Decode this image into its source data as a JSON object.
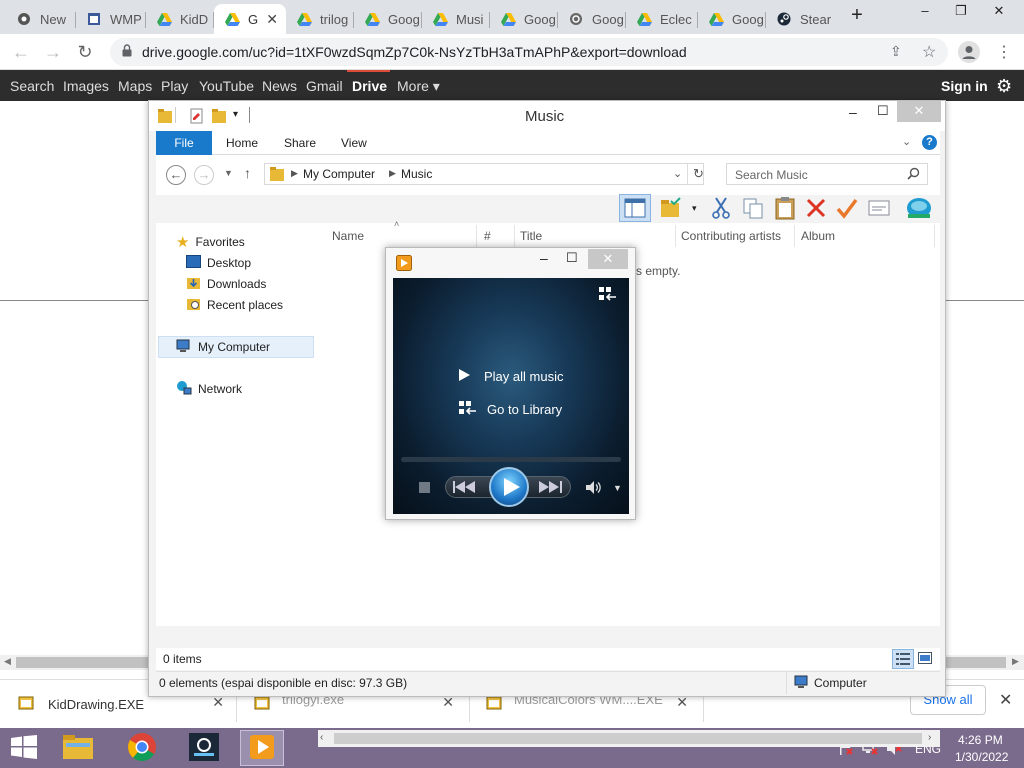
{
  "browser": {
    "tabs": [
      {
        "label": "New",
        "icon": "chrome-icon"
      },
      {
        "label": "WMP",
        "icon": "window-icon"
      },
      {
        "label": "KidD",
        "icon": "google-drive-icon"
      },
      {
        "label": "G",
        "icon": "google-drive-icon",
        "active": true
      },
      {
        "label": "trilog",
        "icon": "google-drive-icon"
      },
      {
        "label": "Goog",
        "icon": "google-drive-icon"
      },
      {
        "label": "Musi",
        "icon": "google-drive-icon"
      },
      {
        "label": "Goog",
        "icon": "google-drive-icon"
      },
      {
        "label": "Goog",
        "icon": "globe-icon"
      },
      {
        "label": "Eclec",
        "icon": "google-drive-icon"
      },
      {
        "label": "Goog",
        "icon": "google-drive-icon"
      },
      {
        "label": "Stear",
        "icon": "steam-icon"
      }
    ],
    "new_tab": "+",
    "url": "drive.google.com/uc?id=1tXF0wzdSqmZp7C0k-NsYzTbH3aTmAPhP&export=download"
  },
  "google_bar": {
    "items": [
      "Search",
      "Images",
      "Maps",
      "Play",
      "YouTube",
      "News",
      "Gmail",
      "Drive",
      "More ▾"
    ],
    "active": "Drive",
    "sign_in": "Sign in"
  },
  "explorer": {
    "title": "Music",
    "ribbon_tabs": [
      "File",
      "Home",
      "Share",
      "View"
    ],
    "breadcrumb": [
      "My Computer",
      "Music"
    ],
    "search_placeholder": "Search Music",
    "nav": {
      "favorites": "Favorites",
      "favorites_items": [
        "Desktop",
        "Downloads",
        "Recent places"
      ],
      "my_computer": "My Computer",
      "network": "Network"
    },
    "columns": [
      "Name",
      "#",
      "Title",
      "Contributing artists",
      "Album"
    ],
    "empty_text": "s empty.",
    "items_count": "0 items",
    "status": "0 elements (espai disponible en disc: 97.3 GB)",
    "status_location": "Computer"
  },
  "wmp": {
    "play_all": "Play all music",
    "go_library": "Go to Library"
  },
  "downloads": {
    "items": [
      "KidDrawing.EXE",
      "trilogyi.exe",
      "MusicalColors WM....EXE"
    ],
    "show_all": "Show all"
  },
  "taskbar": {
    "language": "ENG",
    "time": "4:26 PM",
    "date": "1/30/2022"
  },
  "colors": {
    "accent_file_tab": "#1979ca",
    "google_bar": "#2d2d2d",
    "taskbar": "#7a6b8c"
  }
}
